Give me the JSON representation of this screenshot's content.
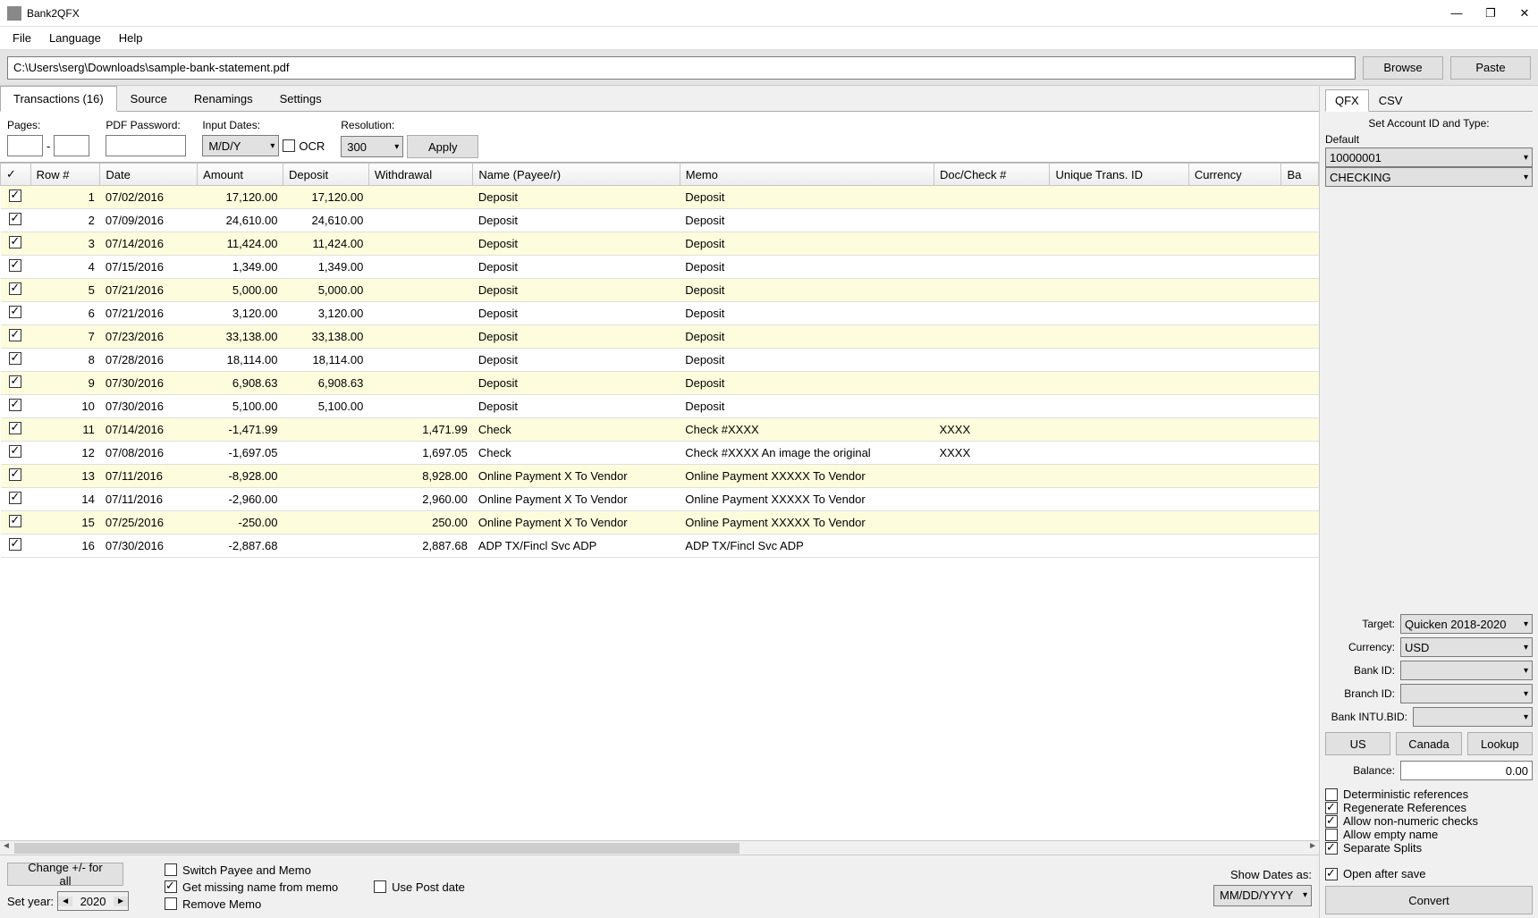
{
  "app_title": "Bank2QFX",
  "window_controls": {
    "min": "—",
    "max": "❐",
    "close": "✕"
  },
  "menu": [
    "File",
    "Language",
    "Help"
  ],
  "file_path": "C:\\Users\\serg\\Downloads\\sample-bank-statement.pdf",
  "browse_btn": "Browse",
  "paste_btn": "Paste",
  "tabs": [
    {
      "label": "Transactions (16)",
      "active": true
    },
    {
      "label": "Source",
      "active": false
    },
    {
      "label": "Renamings",
      "active": false
    },
    {
      "label": "Settings",
      "active": false
    }
  ],
  "options": {
    "pages_label": "Pages:",
    "pages_sep": "-",
    "pdf_pw_label": "PDF Password:",
    "input_dates_label": "Input Dates:",
    "input_dates_value": "M/D/Y",
    "ocr_label": "OCR",
    "resolution_label": "Resolution:",
    "resolution_value": "300",
    "apply_btn": "Apply"
  },
  "columns": [
    "✓",
    "Row #",
    "Date",
    "Amount",
    "Deposit",
    "Withdrawal",
    "Name (Payee/r)",
    "Memo",
    "Doc/Check #",
    "Unique Trans. ID",
    "Currency",
    "Ba"
  ],
  "rows": [
    {
      "c": true,
      "row": 1,
      "date": "07/02/2016",
      "amount": "17,120.00",
      "deposit": "17,120.00",
      "withdrawal": "",
      "name": "Deposit",
      "memo": "Deposit",
      "doc": "",
      "uid": "",
      "cur": "",
      "bal": ""
    },
    {
      "c": true,
      "row": 2,
      "date": "07/09/2016",
      "amount": "24,610.00",
      "deposit": "24,610.00",
      "withdrawal": "",
      "name": "Deposit",
      "memo": "Deposit",
      "doc": "",
      "uid": "",
      "cur": "",
      "bal": ""
    },
    {
      "c": true,
      "row": 3,
      "date": "07/14/2016",
      "amount": "11,424.00",
      "deposit": "11,424.00",
      "withdrawal": "",
      "name": "Deposit",
      "memo": "Deposit",
      "doc": "",
      "uid": "",
      "cur": "",
      "bal": ""
    },
    {
      "c": true,
      "row": 4,
      "date": "07/15/2016",
      "amount": "1,349.00",
      "deposit": "1,349.00",
      "withdrawal": "",
      "name": "Deposit",
      "memo": "Deposit",
      "doc": "",
      "uid": "",
      "cur": "",
      "bal": ""
    },
    {
      "c": true,
      "row": 5,
      "date": "07/21/2016",
      "amount": "5,000.00",
      "deposit": "5,000.00",
      "withdrawal": "",
      "name": "Deposit",
      "memo": "Deposit",
      "doc": "",
      "uid": "",
      "cur": "",
      "bal": ""
    },
    {
      "c": true,
      "row": 6,
      "date": "07/21/2016",
      "amount": "3,120.00",
      "deposit": "3,120.00",
      "withdrawal": "",
      "name": "Deposit",
      "memo": "Deposit",
      "doc": "",
      "uid": "",
      "cur": "",
      "bal": ""
    },
    {
      "c": true,
      "row": 7,
      "date": "07/23/2016",
      "amount": "33,138.00",
      "deposit": "33,138.00",
      "withdrawal": "",
      "name": "Deposit",
      "memo": "Deposit",
      "doc": "",
      "uid": "",
      "cur": "",
      "bal": ""
    },
    {
      "c": true,
      "row": 8,
      "date": "07/28/2016",
      "amount": "18,114.00",
      "deposit": "18,114.00",
      "withdrawal": "",
      "name": "Deposit",
      "memo": "Deposit",
      "doc": "",
      "uid": "",
      "cur": "",
      "bal": ""
    },
    {
      "c": true,
      "row": 9,
      "date": "07/30/2016",
      "amount": "6,908.63",
      "deposit": "6,908.63",
      "withdrawal": "",
      "name": "Deposit",
      "memo": "Deposit",
      "doc": "",
      "uid": "",
      "cur": "",
      "bal": ""
    },
    {
      "c": true,
      "row": 10,
      "date": "07/30/2016",
      "amount": "5,100.00",
      "deposit": "5,100.00",
      "withdrawal": "",
      "name": "Deposit",
      "memo": "Deposit",
      "doc": "",
      "uid": "",
      "cur": "",
      "bal": ""
    },
    {
      "c": true,
      "row": 11,
      "date": "07/14/2016",
      "amount": "-1,471.99",
      "deposit": "",
      "withdrawal": "1,471.99",
      "name": "Check",
      "memo": "Check #XXXX",
      "doc": "XXXX",
      "uid": "",
      "cur": "",
      "bal": ""
    },
    {
      "c": true,
      "row": 12,
      "date": "07/08/2016",
      "amount": "-1,697.05",
      "deposit": "",
      "withdrawal": "1,697.05",
      "name": "Check",
      "memo": "Check #XXXX An image the original",
      "doc": "XXXX",
      "uid": "",
      "cur": "",
      "bal": ""
    },
    {
      "c": true,
      "row": 13,
      "date": "07/11/2016",
      "amount": "-8,928.00",
      "deposit": "",
      "withdrawal": "8,928.00",
      "name": "Online Payment X To Vendor",
      "memo": "Online Payment XXXXX To Vendor",
      "doc": "",
      "uid": "",
      "cur": "",
      "bal": ""
    },
    {
      "c": true,
      "row": 14,
      "date": "07/11/2016",
      "amount": "-2,960.00",
      "deposit": "",
      "withdrawal": "2,960.00",
      "name": "Online Payment X To Vendor",
      "memo": "Online Payment XXXXX To Vendor",
      "doc": "",
      "uid": "",
      "cur": "",
      "bal": ""
    },
    {
      "c": true,
      "row": 15,
      "date": "07/25/2016",
      "amount": "-250.00",
      "deposit": "",
      "withdrawal": "250.00",
      "name": "Online Payment X To Vendor",
      "memo": "Online Payment XXXXX To Vendor",
      "doc": "",
      "uid": "",
      "cur": "",
      "bal": ""
    },
    {
      "c": true,
      "row": 16,
      "date": "07/30/2016",
      "amount": "-2,887.68",
      "deposit": "",
      "withdrawal": "2,887.68",
      "name": "ADP TX/Fincl Svc ADP",
      "memo": "ADP TX/Fincl Svc ADP",
      "doc": "",
      "uid": "",
      "cur": "",
      "bal": ""
    }
  ],
  "bottom": {
    "change_btn": "Change +/- for all",
    "set_year_label": "Set year:",
    "year_value": "2020",
    "switch_payee": "Switch Payee and Memo",
    "get_missing": "Get missing name from memo",
    "remove_memo": "Remove Memo",
    "use_post_date": "Use Post date",
    "show_dates_label": "Show Dates as:",
    "show_dates_value": "MM/DD/YYYY"
  },
  "right": {
    "tabs": [
      {
        "label": "QFX",
        "active": true
      },
      {
        "label": "CSV",
        "active": false
      }
    ],
    "set_acct_label": "Set Account ID and Type:",
    "default_label": "Default",
    "account_id": "10000001",
    "account_type": "CHECKING",
    "target_label": "Target:",
    "target_value": "Quicken 2018-2020",
    "currency_label": "Currency:",
    "currency_value": "USD",
    "bank_id_label": "Bank ID:",
    "branch_id_label": "Branch ID:",
    "intu_bid_label": "Bank INTU.BID:",
    "us_btn": "US",
    "canada_btn": "Canada",
    "lookup_btn": "Lookup",
    "balance_label": "Balance:",
    "balance_value": "0.00",
    "opt_det": "Deterministic references",
    "opt_regen": "Regenerate References",
    "opt_nonnum": "Allow non-numeric checks",
    "opt_empty": "Allow empty name",
    "opt_sep": "Separate Splits",
    "open_after": "Open after save",
    "convert_btn": "Convert"
  }
}
